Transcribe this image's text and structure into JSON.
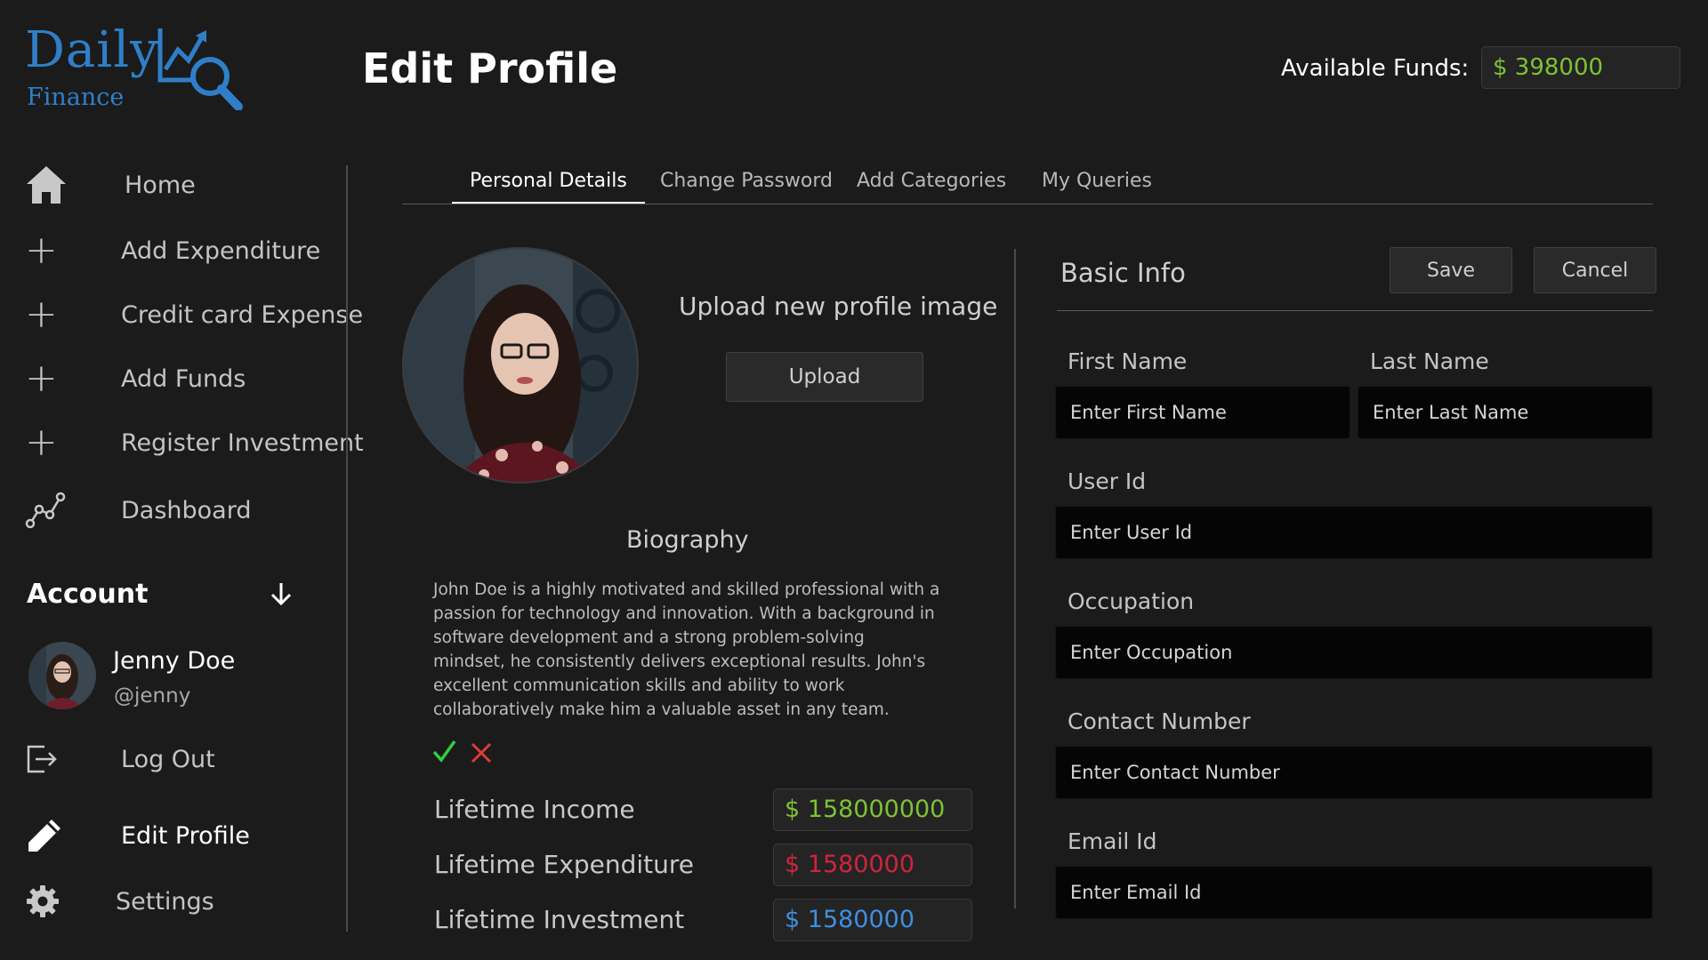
{
  "brand": {
    "name": "Daily",
    "sub": "Finance"
  },
  "header": {
    "title": "Edit Profile",
    "funds_label": "Available Funds:",
    "funds_value": "$ 398000"
  },
  "sidebar": {
    "items": [
      {
        "label": "Home",
        "icon": "home-icon"
      },
      {
        "label": "Add Expenditure",
        "icon": "plus-icon"
      },
      {
        "label": "Credit card Expense",
        "icon": "plus-icon"
      },
      {
        "label": "Add Funds",
        "icon": "plus-icon"
      },
      {
        "label": "Register Investment",
        "icon": "plus-icon"
      },
      {
        "label": "Dashboard",
        "icon": "line-chart-icon"
      }
    ],
    "account_label": "Account",
    "user": {
      "name": "Jenny Doe",
      "handle": "@jenny"
    },
    "logout_label": "Log Out",
    "edit_profile_label": "Edit Profile",
    "settings_label": "Settings"
  },
  "tabs": [
    {
      "label": "Personal Details",
      "active": true
    },
    {
      "label": "Change Password",
      "active": false
    },
    {
      "label": "Add Categories",
      "active": false
    },
    {
      "label": "My Queries",
      "active": false
    }
  ],
  "profile": {
    "upload_title": "Upload new profile image",
    "upload_button": "Upload",
    "bio_title": "Biography",
    "bio_text": "John Doe is a highly motivated and skilled professional with a passion for technology and innovation. With a background in software development and a strong problem-solving mindset, he consistently delivers exceptional results. John's excellent communication skills and ability to work collaboratively make him a valuable asset in any team."
  },
  "stats": [
    {
      "label": "Lifetime Income",
      "value": "$ 158000000",
      "color": "#7dc234"
    },
    {
      "label": "Lifetime Expenditure",
      "value": "$ 1580000",
      "color": "#d0243c"
    },
    {
      "label": "Lifetime Investment",
      "value": "$ 1580000",
      "color": "#3f8fe0"
    }
  ],
  "basic_info": {
    "title": "Basic Info",
    "save": "Save",
    "cancel": "Cancel",
    "first_name": {
      "label": "First Name",
      "placeholder": "Enter First Name"
    },
    "last_name": {
      "label": "Last Name",
      "placeholder": "Enter Last Name"
    },
    "user_id": {
      "label": "User Id",
      "placeholder": "Enter User Id"
    },
    "occupation": {
      "label": "Occupation",
      "placeholder": "Enter Occupation"
    },
    "contact": {
      "label": "Contact Number",
      "placeholder": "Enter Contact Number"
    },
    "email": {
      "label": "Email Id",
      "placeholder": "Enter Email Id"
    }
  },
  "colors": {
    "background": "#1b1b1b",
    "brand_blue": "#2f7fc8",
    "funds_green": "#7dc234",
    "expense_red": "#d0243c",
    "invest_blue": "#3f8fe0"
  }
}
